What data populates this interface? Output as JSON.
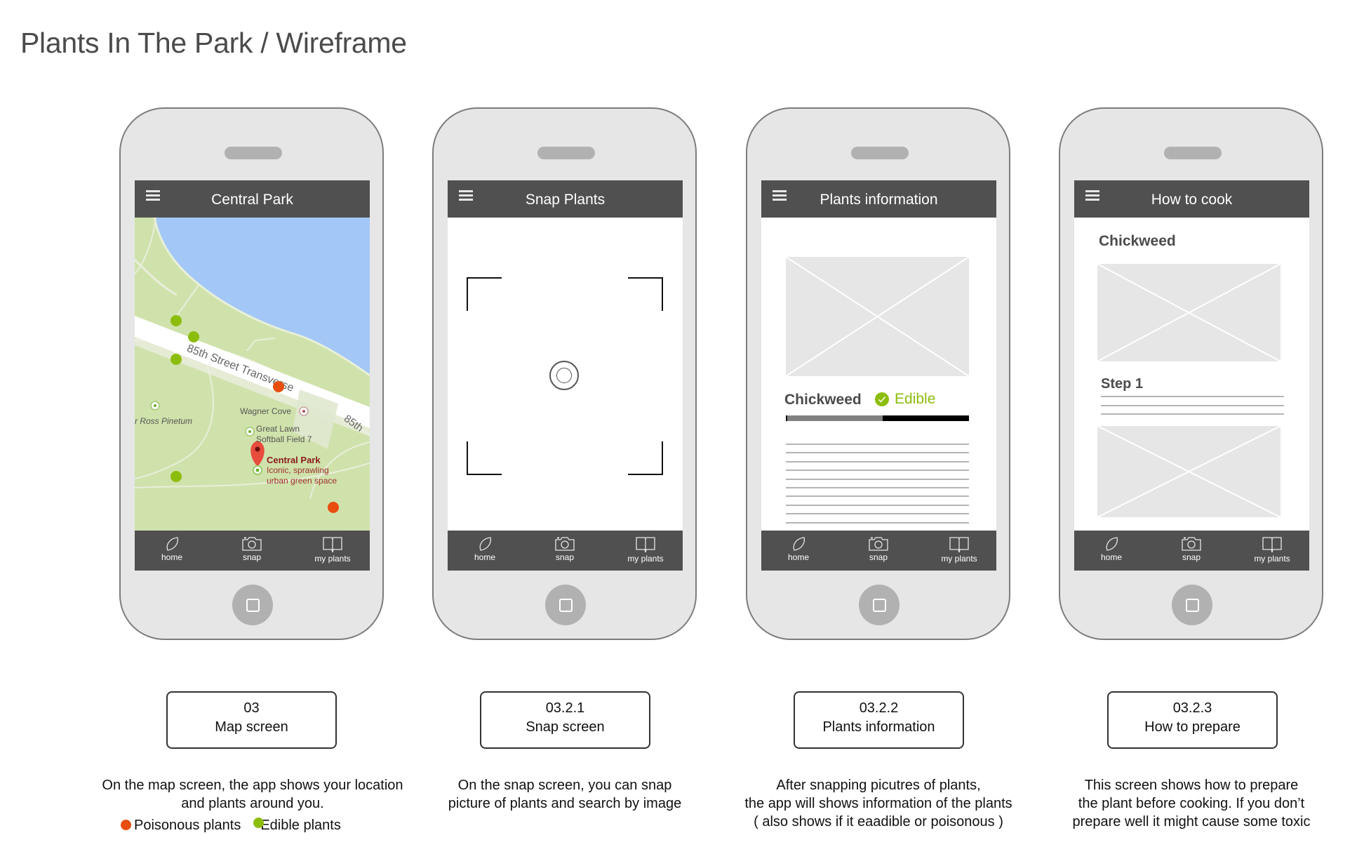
{
  "page": {
    "title_main": "Plants In The Park",
    "title_separator": " / ",
    "title_sub": "Wireframe"
  },
  "colors": {
    "poisonous": "#e84e0f",
    "edible": "#8dbd0c",
    "header_bg": "#505050",
    "phone_body": "#e6e6e6"
  },
  "tabbar": {
    "items": [
      {
        "icon": "leaf-icon",
        "label": "home"
      },
      {
        "icon": "camera-icon",
        "label": "snap"
      },
      {
        "icon": "book-icon",
        "label": "my plants"
      }
    ]
  },
  "screens": [
    {
      "header_title": "Central Park",
      "map": {
        "street_label": "85th Street Transverse",
        "street_label_short": "85th",
        "places": [
          "Wagner Cove",
          "Great Lawn",
          "Softball Field 7",
          "r Ross Pinetum"
        ],
        "pin_title": "Central Park",
        "pin_desc_1": "Iconic, sprawling",
        "pin_desc_2": "urban green space",
        "markers": [
          {
            "type": "edible"
          },
          {
            "type": "edible"
          },
          {
            "type": "edible"
          },
          {
            "type": "edible"
          },
          {
            "type": "poisonous"
          },
          {
            "type": "poisonous"
          }
        ]
      },
      "label_number": "03",
      "label_name": "Map screen",
      "description": [
        "On the map screen, the app shows your location",
        "and plants around you."
      ],
      "legend": {
        "poisonous": "Poisonous plants",
        "edible": "Edible plants"
      }
    },
    {
      "header_title": "Snap Plants",
      "label_number": "03.2.1",
      "label_name": "Snap screen",
      "description": [
        "On the snap screen, you can snap",
        "picture of plants and search by image"
      ]
    },
    {
      "header_title": "Plants information",
      "plant_name": "Chickweed",
      "status": "Edible",
      "progress_fraction": 0.52,
      "text_line_count": 10,
      "label_number": "03.2.2",
      "label_name": "Plants information",
      "description": [
        "After snapping picutres of plants,",
        "the app will shows information of the plants",
        "( also shows if it eaadible or poisonous )"
      ]
    },
    {
      "header_title": "How to cook",
      "plant_name": "Chickweed",
      "step_title": "Step 1",
      "step_line_count": 3,
      "label_number": "03.2.3",
      "label_name": "How to prepare",
      "description": [
        "This screen shows how to prepare",
        "the plant before cooking. If you don’t",
        "prepare well it might cause some toxic"
      ]
    }
  ]
}
